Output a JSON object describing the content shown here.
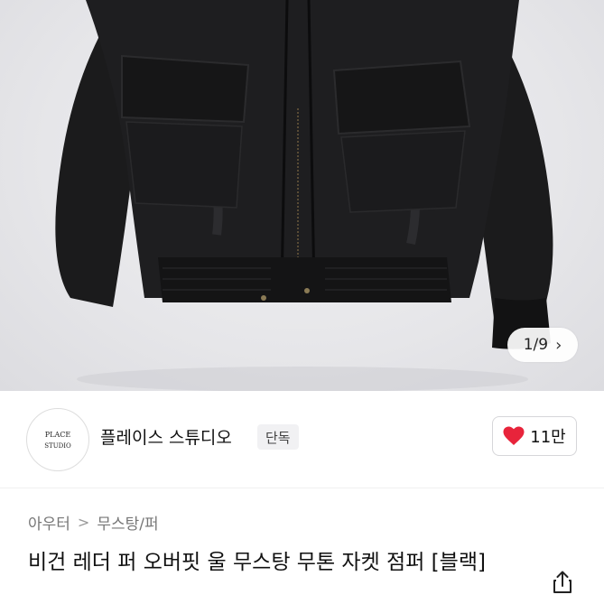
{
  "gallery": {
    "counter": "1/9",
    "next_icon": "chevron-right-icon"
  },
  "brand": {
    "logo_text_top": "PLACE",
    "logo_text_bottom": "STUDIO",
    "name": "플레이스 스튜디오",
    "badge": "단독"
  },
  "like": {
    "icon": "heart-icon",
    "color": "#e8243b",
    "count": "11만"
  },
  "breadcrumb": {
    "items": [
      "아우터",
      "무스탕/퍼"
    ],
    "separator": ">"
  },
  "product": {
    "title": "비건 레더 퍼 오버핏 울 무스탕 무톤 자켓 점퍼 [블랙]"
  },
  "actions": {
    "share_icon": "share-icon"
  }
}
